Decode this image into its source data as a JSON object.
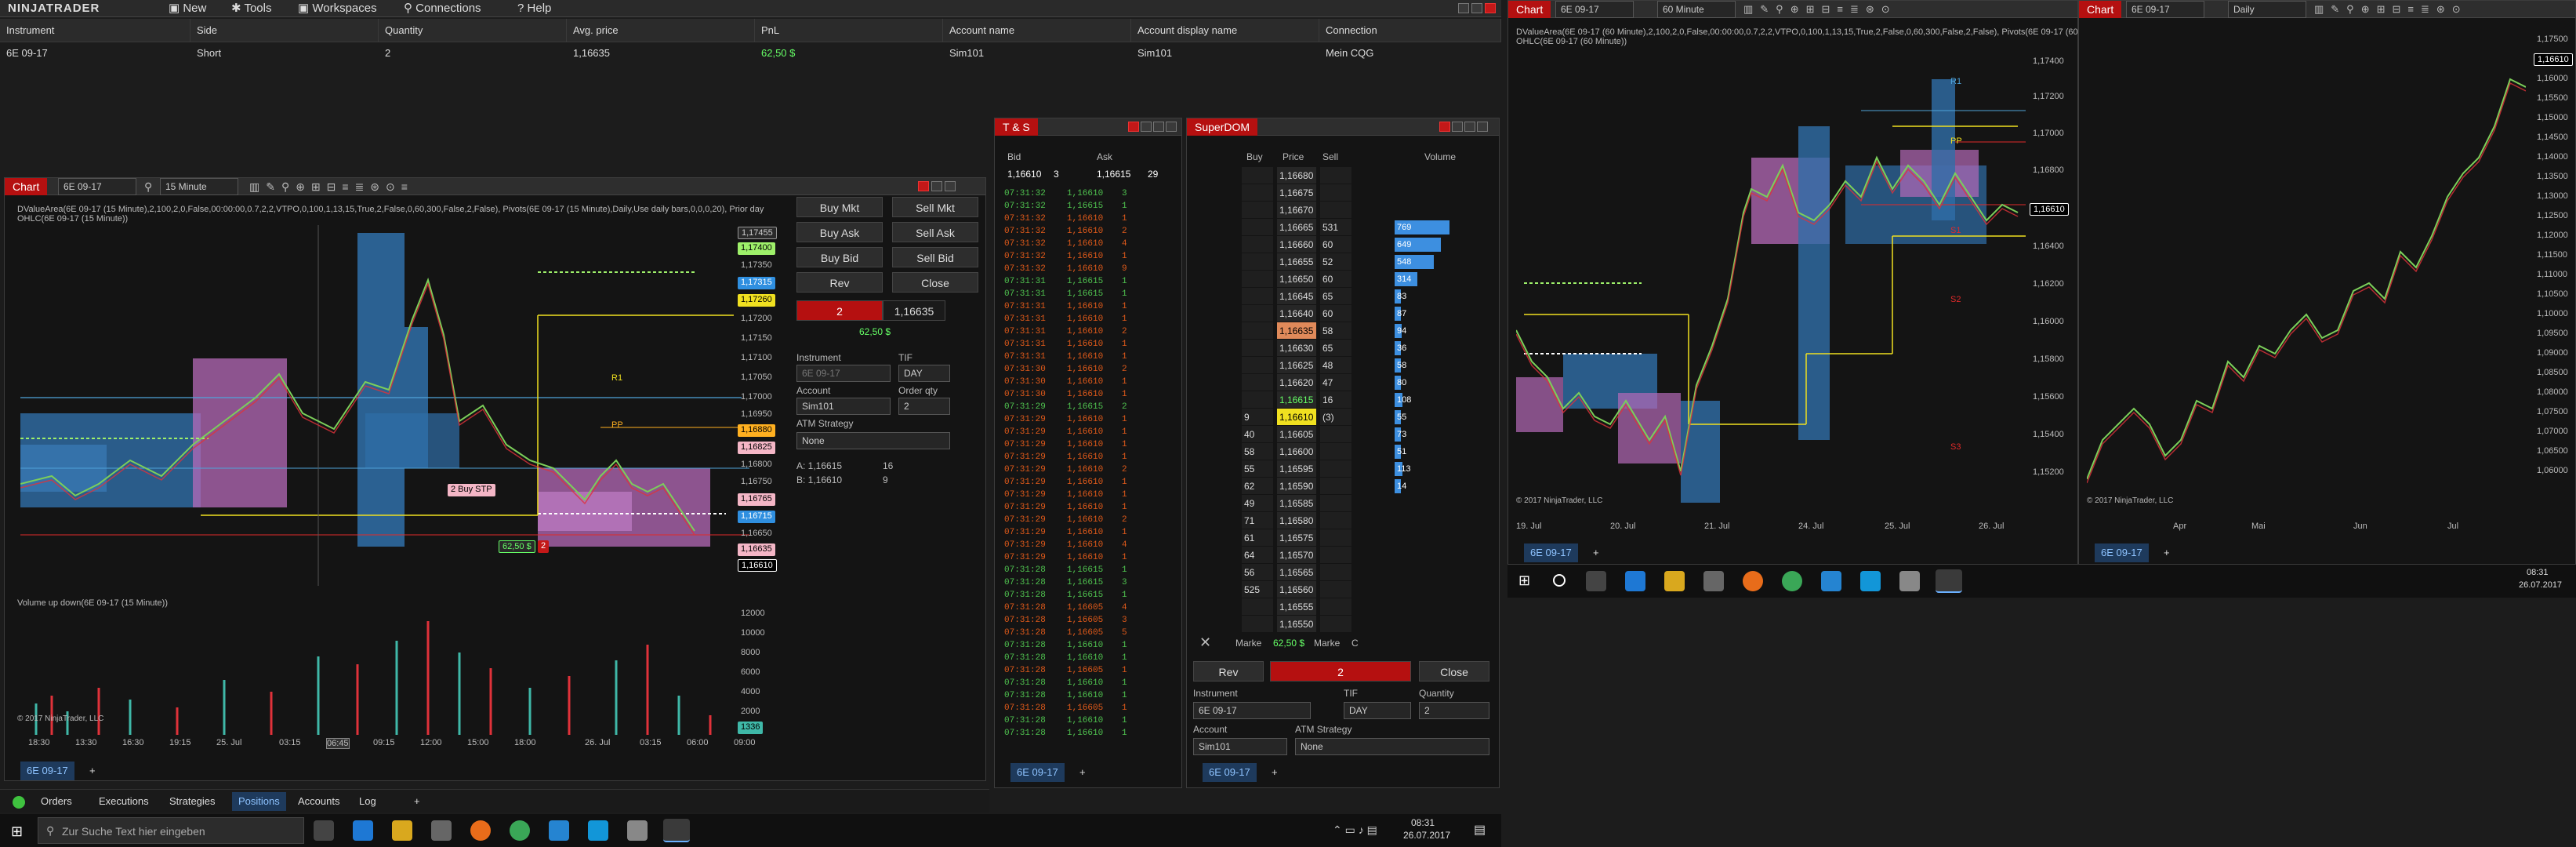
{
  "menu": {
    "logo": "NINJATRADER",
    "items": [
      "New",
      "Tools",
      "Workspaces",
      "Connections",
      "Help"
    ]
  },
  "positions_grid": {
    "headers": [
      "Instrument",
      "Side",
      "Quantity",
      "Avg. price",
      "PnL",
      "Account name",
      "Account display name",
      "Connection"
    ],
    "row": [
      "6E 09-17",
      "Short",
      "2",
      "1,16635",
      "62,50 $",
      "Sim101",
      "Sim101",
      "Mein CQG"
    ]
  },
  "chart1": {
    "tab": "Chart",
    "instrument": "6E 09-17",
    "interval": "15 Minute",
    "indicator_line1": "DValueArea(6E 09-17 (15 Minute),2,100,2,0,False,00:00:00,0.7,2,2,VTPO,0,100,1,13,15,True,2,False,0,60,300,False,2,False), Pivots(6E 09-17 (15 Minute),Daily,Use daily bars,0,0,0,20), Prior day",
    "indicator_line2": "OHLC(6E 09-17 (15 Minute))",
    "volume_label": "Volume up down(6E 09-17 (15 Minute))",
    "copyright": "© 2017 NinjaTrader, LLC",
    "price_labels": [
      "1,17455",
      "1,17400",
      "1,17350",
      "1,17315",
      "1,17260",
      "1,17200",
      "1,17150",
      "1,17100",
      "1,17050",
      "1,17000",
      "1,16950",
      "1,16880",
      "1,16825",
      "1,16800",
      "1,16750",
      "1,16765",
      "1,16715",
      "1,16650",
      "1,16635",
      "1,16610"
    ],
    "vol_labels": [
      "12000",
      "10000",
      "8000",
      "6000",
      "4000",
      "2000",
      "1336"
    ],
    "time_labels": [
      "18:30",
      "13:30",
      "16:30",
      "19:15",
      "25. Jul",
      "03:15",
      "06:45",
      "09:15",
      "12:00",
      "15:00",
      "18:00",
      "26. Jul",
      "03:15",
      "06:00",
      "09:00"
    ],
    "markers": {
      "r1": "R1",
      "pp": "PP",
      "order": "2  Buy STP",
      "pnl": "62,50 $",
      "qty": "2"
    },
    "tab_bottom": "6E 09-17"
  },
  "order_panel": {
    "buy_mkt": "Buy Mkt",
    "sell_mkt": "Sell Mkt",
    "buy_ask": "Buy Ask",
    "sell_ask": "Sell Ask",
    "buy_bid": "Buy Bid",
    "sell_bid": "Sell Bid",
    "rev": "Rev",
    "close": "Close",
    "pos_qty": "2",
    "pos_price": "1,16635",
    "pnl": "62,50 $",
    "instrument_lbl": "Instrument",
    "instrument": "6E 09-17",
    "tif_lbl": "TIF",
    "tif": "DAY",
    "account_lbl": "Account",
    "account": "Sim101",
    "qty_lbl": "Order qty",
    "qty": "2",
    "atm_lbl": "ATM Strategy",
    "atm": "None",
    "ask_line": "A:  1,16615",
    "ask_size": "16",
    "bid_line": "B:  1,16610",
    "bid_size": "9"
  },
  "ts": {
    "title": "T & S",
    "bid_hdr": "Bid",
    "ask_hdr": "Ask",
    "bid": "1,16610",
    "bid_size": "3",
    "ask": "1,16615",
    "ask_size": "29",
    "tab": "6E 09-17",
    "rows": [
      [
        "07:31:32",
        "1,16610",
        "3",
        "g"
      ],
      [
        "07:31:32",
        "1,16615",
        "1",
        "g"
      ],
      [
        "07:31:32",
        "1,16610",
        "1",
        "r"
      ],
      [
        "07:31:32",
        "1,16610",
        "2",
        "r"
      ],
      [
        "07:31:32",
        "1,16610",
        "4",
        "r"
      ],
      [
        "07:31:32",
        "1,16610",
        "1",
        "r"
      ],
      [
        "07:31:32",
        "1,16610",
        "9",
        "r"
      ],
      [
        "07:31:31",
        "1,16615",
        "1",
        "g"
      ],
      [
        "07:31:31",
        "1,16615",
        "1",
        "g"
      ],
      [
        "07:31:31",
        "1,16610",
        "1",
        "r"
      ],
      [
        "07:31:31",
        "1,16610",
        "1",
        "r"
      ],
      [
        "07:31:31",
        "1,16610",
        "2",
        "r"
      ],
      [
        "07:31:31",
        "1,16610",
        "1",
        "r"
      ],
      [
        "07:31:31",
        "1,16610",
        "1",
        "r"
      ],
      [
        "07:31:30",
        "1,16610",
        "2",
        "r"
      ],
      [
        "07:31:30",
        "1,16610",
        "1",
        "r"
      ],
      [
        "07:31:30",
        "1,16610",
        "1",
        "r"
      ],
      [
        "07:31:29",
        "1,16615",
        "2",
        "g"
      ],
      [
        "07:31:29",
        "1,16610",
        "1",
        "r"
      ],
      [
        "07:31:29",
        "1,16610",
        "1",
        "r"
      ],
      [
        "07:31:29",
        "1,16610",
        "1",
        "r"
      ],
      [
        "07:31:29",
        "1,16610",
        "1",
        "r"
      ],
      [
        "07:31:29",
        "1,16610",
        "2",
        "r"
      ],
      [
        "07:31:29",
        "1,16610",
        "1",
        "r"
      ],
      [
        "07:31:29",
        "1,16610",
        "1",
        "r"
      ],
      [
        "07:31:29",
        "1,16610",
        "1",
        "r"
      ],
      [
        "07:31:29",
        "1,16610",
        "2",
        "r"
      ],
      [
        "07:31:29",
        "1,16610",
        "1",
        "r"
      ],
      [
        "07:31:29",
        "1,16610",
        "4",
        "r"
      ],
      [
        "07:31:29",
        "1,16610",
        "1",
        "r"
      ],
      [
        "07:31:28",
        "1,16615",
        "1",
        "g"
      ],
      [
        "07:31:28",
        "1,16615",
        "3",
        "g"
      ],
      [
        "07:31:28",
        "1,16615",
        "1",
        "g"
      ],
      [
        "07:31:28",
        "1,16605",
        "4",
        "r"
      ],
      [
        "07:31:28",
        "1,16605",
        "3",
        "r"
      ],
      [
        "07:31:28",
        "1,16605",
        "5",
        "r"
      ],
      [
        "07:31:28",
        "1,16610",
        "1",
        "g"
      ],
      [
        "07:31:28",
        "1,16610",
        "1",
        "g"
      ],
      [
        "07:31:28",
        "1,16605",
        "1",
        "r"
      ],
      [
        "07:31:28",
        "1,16610",
        "1",
        "g"
      ],
      [
        "07:31:28",
        "1,16610",
        "1",
        "g"
      ],
      [
        "07:31:28",
        "1,16605",
        "1",
        "r"
      ],
      [
        "07:31:28",
        "1,16610",
        "1",
        "g"
      ],
      [
        "07:31:28",
        "1,16610",
        "1",
        "g"
      ]
    ]
  },
  "superdom": {
    "title": "SuperDOM",
    "hdr_buy": "Buy",
    "hdr_price": "Price",
    "hdr_sell": "Sell",
    "hdr_vol": "Volume",
    "rows": [
      [
        "",
        "1,16680",
        "",
        "",
        ""
      ],
      [
        "",
        "1,16675",
        "",
        "",
        ""
      ],
      [
        "",
        "1,16670",
        "",
        "",
        ""
      ],
      [
        "",
        "1,16665",
        "531",
        "769",
        ""
      ],
      [
        "",
        "1,16660",
        "60",
        "649",
        ""
      ],
      [
        "",
        "1,16655",
        "52",
        "548",
        ""
      ],
      [
        "",
        "1,16650",
        "60",
        "314",
        ""
      ],
      [
        "",
        "1,16645",
        "65",
        "83",
        ""
      ],
      [
        "",
        "1,16640",
        "60",
        "87",
        ""
      ],
      [
        "",
        "1,16635",
        "58",
        "94",
        ""
      ],
      [
        "",
        "1,16630",
        "65",
        "36",
        ""
      ],
      [
        "",
        "1,16625",
        "48",
        "58",
        ""
      ],
      [
        "",
        "1,16620",
        "47",
        "80",
        ""
      ],
      [
        "",
        "1,16615",
        "16",
        "108",
        ""
      ],
      [
        "9",
        "1,16610",
        "(3)",
        "55",
        ""
      ],
      [
        "40",
        "1,16605",
        "",
        "73",
        ""
      ],
      [
        "58",
        "1,16600",
        "",
        "51",
        ""
      ],
      [
        "55",
        "1,16595",
        "",
        "113",
        ""
      ],
      [
        "62",
        "1,16590",
        "",
        "14",
        ""
      ],
      [
        "49",
        "1,16585",
        "",
        "",
        ""
      ],
      [
        "71",
        "1,16580",
        "",
        "",
        ""
      ],
      [
        "61",
        "1,16575",
        "",
        "",
        ""
      ],
      [
        "64",
        "1,16570",
        "",
        "",
        ""
      ],
      [
        "56",
        "1,16565",
        "",
        "",
        ""
      ],
      [
        "525",
        "1,16560",
        "",
        "",
        ""
      ],
      [
        "",
        "1,16555",
        "",
        "",
        ""
      ],
      [
        "",
        "1,16550",
        "",
        "",
        ""
      ]
    ],
    "marke1": "Marke",
    "pnl": "62,50 $",
    "marke2": "Marke",
    "c": "C",
    "rev": "Rev",
    "pos": "2",
    "close": "Close",
    "instrument_lbl": "Instrument",
    "tif_lbl": "TIF",
    "qty_lbl": "Quantity",
    "instrument": "6E 09-17",
    "tif": "DAY",
    "qty": "2",
    "account_lbl": "Account",
    "atm_lbl": "ATM Strategy",
    "account": "Sim101",
    "atm": "None",
    "tab": "6E 09-17"
  },
  "bottom_tabs": [
    "Orders",
    "Executions",
    "Strategies",
    "Positions",
    "Accounts",
    "Log"
  ],
  "taskbar": {
    "search": "Zur Suche Text hier eingeben",
    "time": "08:31",
    "date": "26.07.2017"
  },
  "chart2": {
    "tab": "Chart",
    "instrument": "6E 09-17",
    "interval": "60 Minute",
    "indicator_line1": "DValueArea(6E 09-17 (60 Minute),2,100,2,0,False,00:00:00,0.7,2,2,VTPO,0,100,1,13,15,True,2,False,0,60,300,False,2,False), Pivots(6E 09-17 (60 Minute),Daily,Use daily bars,0,0,0,20), Prior day",
    "indicator_line2": "OHLC(6E 09-17 (60 Minute))",
    "copyright": "© 2017 NinjaTrader, LLC",
    "price_labels": [
      "1,17400",
      "1,17200",
      "1,17000",
      "1,16800",
      "1,16610",
      "1,16400",
      "1,16200",
      "1,16000",
      "1,15800",
      "1,15600",
      "1,15400",
      "1,15200"
    ],
    "time_labels": [
      "19. Jul",
      "20. Jul",
      "21. Jul",
      "24. Jul",
      "25. Jul",
      "26. Jul"
    ],
    "markers": {
      "r1": "R1",
      "pp": "PP",
      "s1": "S1",
      "s2": "S2",
      "s3": "S3"
    },
    "tab_bottom": "6E 09-17"
  },
  "chart3": {
    "tab": "Chart",
    "instrument": "6E 09-17",
    "interval": "Daily",
    "copyright": "© 2017 NinjaTrader, LLC",
    "price_labels": [
      "1,17500",
      "1,16610",
      "1,16000",
      "1,15500",
      "1,15000",
      "1,14500",
      "1,14000",
      "1,13500",
      "1,13000",
      "1,12500",
      "1,12000",
      "1,11500",
      "1,11000",
      "1,10500",
      "1,10000",
      "1,09500",
      "1,09000",
      "1,08500",
      "1,08000",
      "1,07500",
      "1,07000",
      "1,06500",
      "1,06000"
    ],
    "time_labels": [
      "Apr",
      "Mai",
      "Jun",
      "Jul"
    ],
    "tab_bottom": "6E 09-17"
  },
  "taskbar2": {
    "time": "08:31",
    "date": "26.07.2017"
  },
  "colors": {
    "accent_red": "#b51010",
    "blue_profile": "#2f6ea8",
    "pink_profile": "#b56ab8",
    "up": "#4caf50",
    "down": "#e0323a",
    "yellow": "#f0e020"
  }
}
